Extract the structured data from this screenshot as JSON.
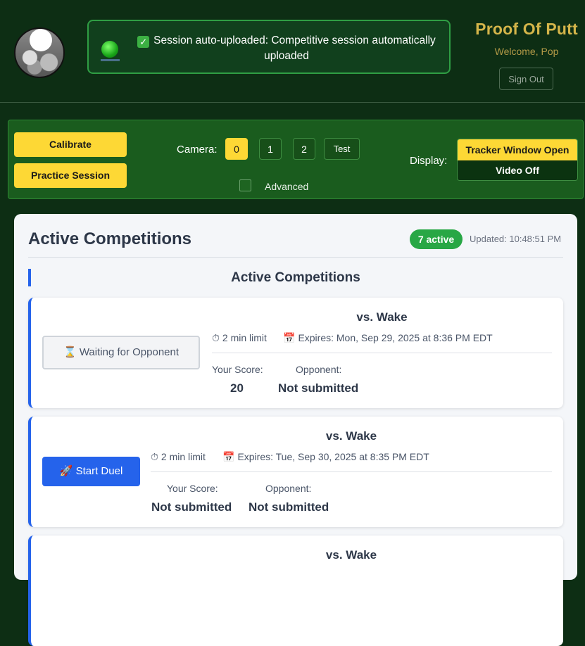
{
  "header": {
    "notice_text": "Session auto-uploaded: Competitive session automatically uploaded",
    "app_title": "Proof Of Putt",
    "welcome": "Welcome, Pop",
    "sign_out": "Sign Out"
  },
  "toolbar": {
    "calibrate": "Calibrate",
    "practice": "Practice Session",
    "camera_label": "Camera:",
    "cameras": [
      "0",
      "1",
      "2"
    ],
    "selected_camera": "0",
    "test": "Test",
    "advanced": "Advanced",
    "advanced_checked": false,
    "display_label": "Display:",
    "display_options": [
      "Tracker Window Open",
      "Video Off"
    ]
  },
  "panel": {
    "title": "Active Competitions",
    "badge": "7 active",
    "updated": "Updated: 10:48:51 PM",
    "subtitle": "Active Competitions",
    "competitions": [
      {
        "opponent": "vs. Wake",
        "limit": "2 min limit",
        "expires": "Expires: Mon, Sep 29, 2025 at 8:36 PM EDT",
        "your_score_label": "Your Score:",
        "your_score": "20",
        "opponent_label": "Opponent:",
        "opponent_score": "Not submitted",
        "action": "Waiting for Opponent"
      },
      {
        "opponent": "vs. Wake",
        "limit": "2 min limit",
        "expires": "Expires: Tue, Sep 30, 2025 at 8:35 PM EDT",
        "your_score_label": "Your Score:",
        "your_score": "Not submitted",
        "opponent_label": "Opponent:",
        "opponent_score": "Not submitted",
        "action": "Start Duel"
      },
      {
        "opponent": "vs. Wake"
      }
    ]
  },
  "colors": {
    "background": "#0d2e14",
    "accent_yellow": "#fdd835",
    "brand_gold": "#d4b54a",
    "primary_blue": "#2563eb",
    "active_green": "#28a745"
  },
  "icons": {
    "notice_check": "check-mark-button",
    "timer": "stopwatch",
    "calendar": "calendar",
    "hourglass": "hourglass",
    "rocket": "rocket"
  }
}
